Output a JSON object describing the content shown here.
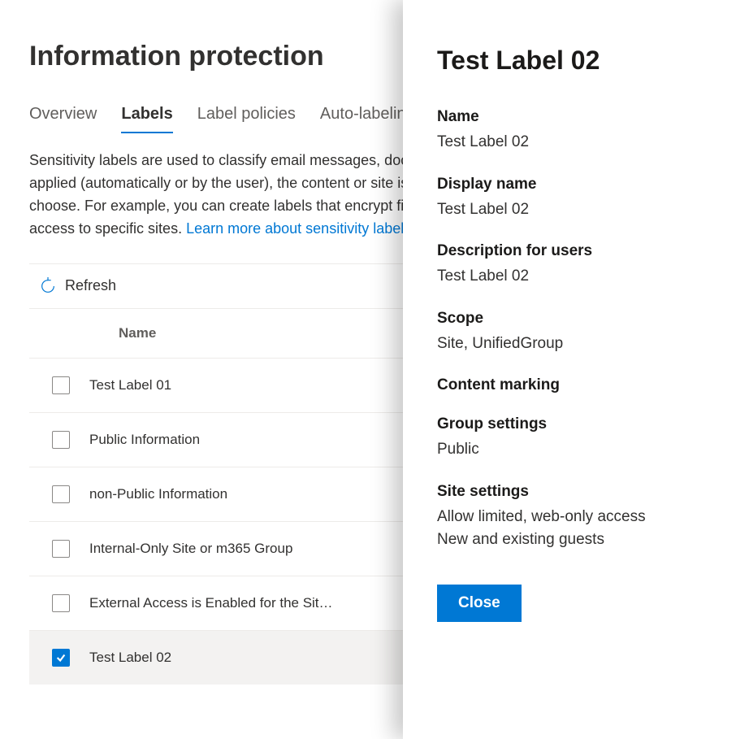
{
  "page": {
    "title": "Information protection",
    "description_part1": "Sensitivity labels are used to classify email messages, documents, sites, and more. When a label is applied (automatically or by the user), the content or site is protected based on the settings you choose. For example, you can create labels that encrypt files, add content marking, and control user access to specific sites. ",
    "learn_more_text": "Learn more about sensitivity labels"
  },
  "tabs": [
    {
      "label": "Overview",
      "active": false
    },
    {
      "label": "Labels",
      "active": true
    },
    {
      "label": "Label policies",
      "active": false
    },
    {
      "label": "Auto-labeling",
      "active": false
    }
  ],
  "toolbar": {
    "refresh_label": "Refresh"
  },
  "table": {
    "column_name": "Name",
    "rows": [
      {
        "name": "Test Label 01",
        "selected": false
      },
      {
        "name": "Public Information",
        "selected": false
      },
      {
        "name": "non-Public Information",
        "selected": false
      },
      {
        "name": "Internal-Only Site or m365 Group",
        "selected": false
      },
      {
        "name": "External Access is Enabled for the Sit…",
        "selected": false
      },
      {
        "name": "Test Label 02",
        "selected": true
      }
    ]
  },
  "panel": {
    "title": "Test Label 02",
    "fields": [
      {
        "label": "Name",
        "value": "Test Label 02"
      },
      {
        "label": "Display name",
        "value": "Test Label 02"
      },
      {
        "label": "Description for users",
        "value": "Test Label 02"
      },
      {
        "label": "Scope",
        "value": "Site, UnifiedGroup"
      },
      {
        "label": "Content marking",
        "value": ""
      },
      {
        "label": "Group settings",
        "value": "Public"
      },
      {
        "label": "Site settings",
        "value": "Allow limited, web-only access\nNew and existing guests"
      }
    ],
    "close_label": "Close"
  }
}
